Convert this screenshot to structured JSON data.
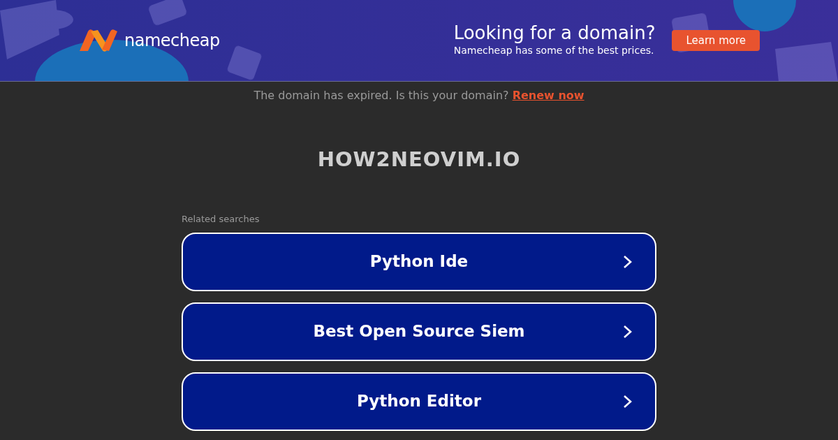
{
  "banner": {
    "logo_text": "namecheap",
    "headline": "Looking for a domain?",
    "subline": "Namecheap has some of the best prices.",
    "button": "Learn more"
  },
  "notice": {
    "text": "The domain has expired. Is this your domain?",
    "link": "Renew now"
  },
  "domain": "HOW2NEOVIM.IO",
  "related": {
    "label": "Related searches",
    "items": [
      {
        "label": "Python Ide"
      },
      {
        "label": "Best Open Source Siem"
      },
      {
        "label": "Python Editor"
      }
    ]
  }
}
